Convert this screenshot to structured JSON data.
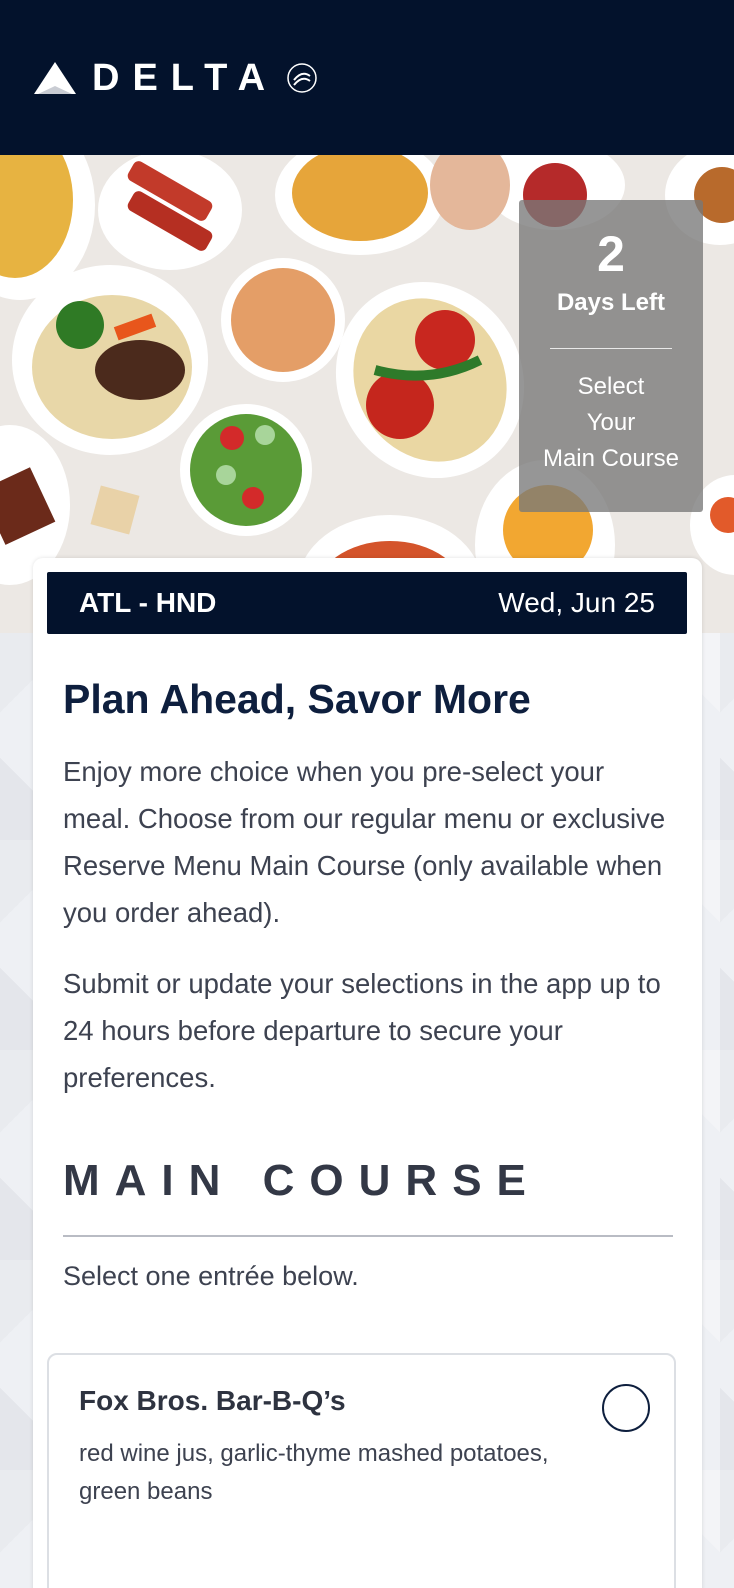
{
  "header": {
    "brand": "DELTA",
    "logo_icon": "delta-widget-icon",
    "alliance_icon": "skyteam-icon"
  },
  "hero": {
    "image": "food-spread-photo",
    "countdown": {
      "number": "2",
      "label": "Days Left",
      "cta_line1": "Select",
      "cta_line2": "Your",
      "cta_line3": "Main Course"
    }
  },
  "flight": {
    "route": "ATL - HND",
    "date": "Wed, Jun 25"
  },
  "intro": {
    "title": "Plan Ahead, Savor More",
    "paragraph1": "Enjoy more choice when you pre-select your meal. Choose from our regular menu or exclusive Reserve Menu Main Course (only available when you order ahead).",
    "paragraph2": "Submit or update your selections in the app up to 24 hours before departure to secure your preferences."
  },
  "main_course": {
    "heading": "MAIN COURSE",
    "instruction": "Select one entrée below.",
    "options": [
      {
        "name": "Fox Bros. Bar-B-Q’s",
        "description": "red wine jus, garlic-thyme mashed potatoes, green beans",
        "selected": false
      }
    ]
  },
  "colors": {
    "navy": "#03122c",
    "title_navy": "#0e1f3e",
    "body_text": "#3d4250",
    "card_bg": "#ffffff"
  }
}
